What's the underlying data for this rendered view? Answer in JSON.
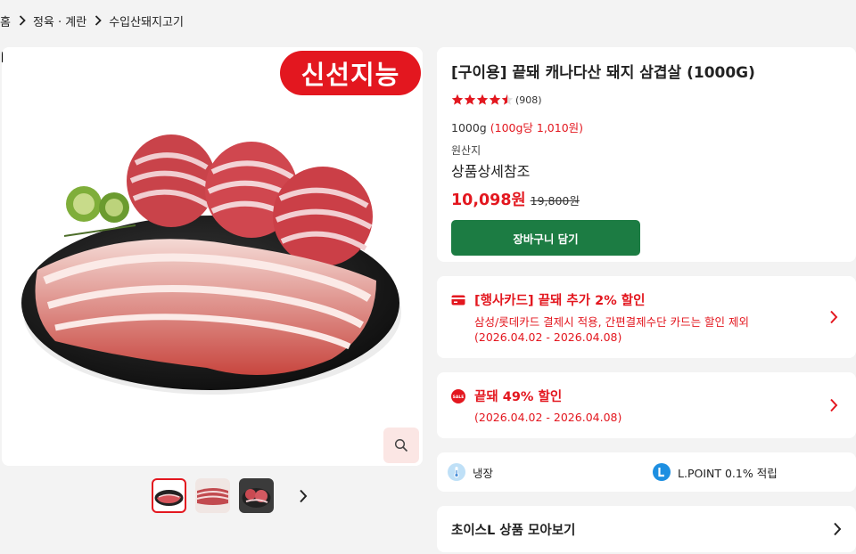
{
  "breadcrumb": {
    "items": [
      "홈",
      "정육 · 계란",
      "수입산돼지고기"
    ]
  },
  "product_image": {
    "badge": "신선지능"
  },
  "product": {
    "title": "[구이용] 끝돼 캐나다산 돼지 삼겹살 (1000G)",
    "rating": 4.5,
    "review_count": "(908)",
    "unit_weight": "1000g",
    "unit_price": "(100g당 1,010원)",
    "origin_label": "원산지",
    "origin_value": "상품상세참조",
    "price": "10,098원",
    "original_price": "19,800원",
    "cart_button": "장바구니 담기"
  },
  "promotions": [
    {
      "title": "[행사카드] 끝돼 추가 2% 할인",
      "lines": [
        "삼성/롯데카드 결제시 적용, 간편결제수단 카드는 할인 제외",
        "(2026.04.02 - 2026.04.08)"
      ],
      "icon": "card-icon"
    },
    {
      "title": "끝돼 49% 할인",
      "lines": [
        "(2026.04.02 - 2026.04.08)"
      ],
      "icon": "sale-icon"
    }
  ],
  "storage": {
    "type": "냉장",
    "point": "L.POINT 0.1% 적립"
  },
  "choice_link": "초이스L 상품 모아보기",
  "colors": {
    "accent": "#e3171f",
    "cart": "#1c7c43",
    "background": "#f3f3f3"
  }
}
